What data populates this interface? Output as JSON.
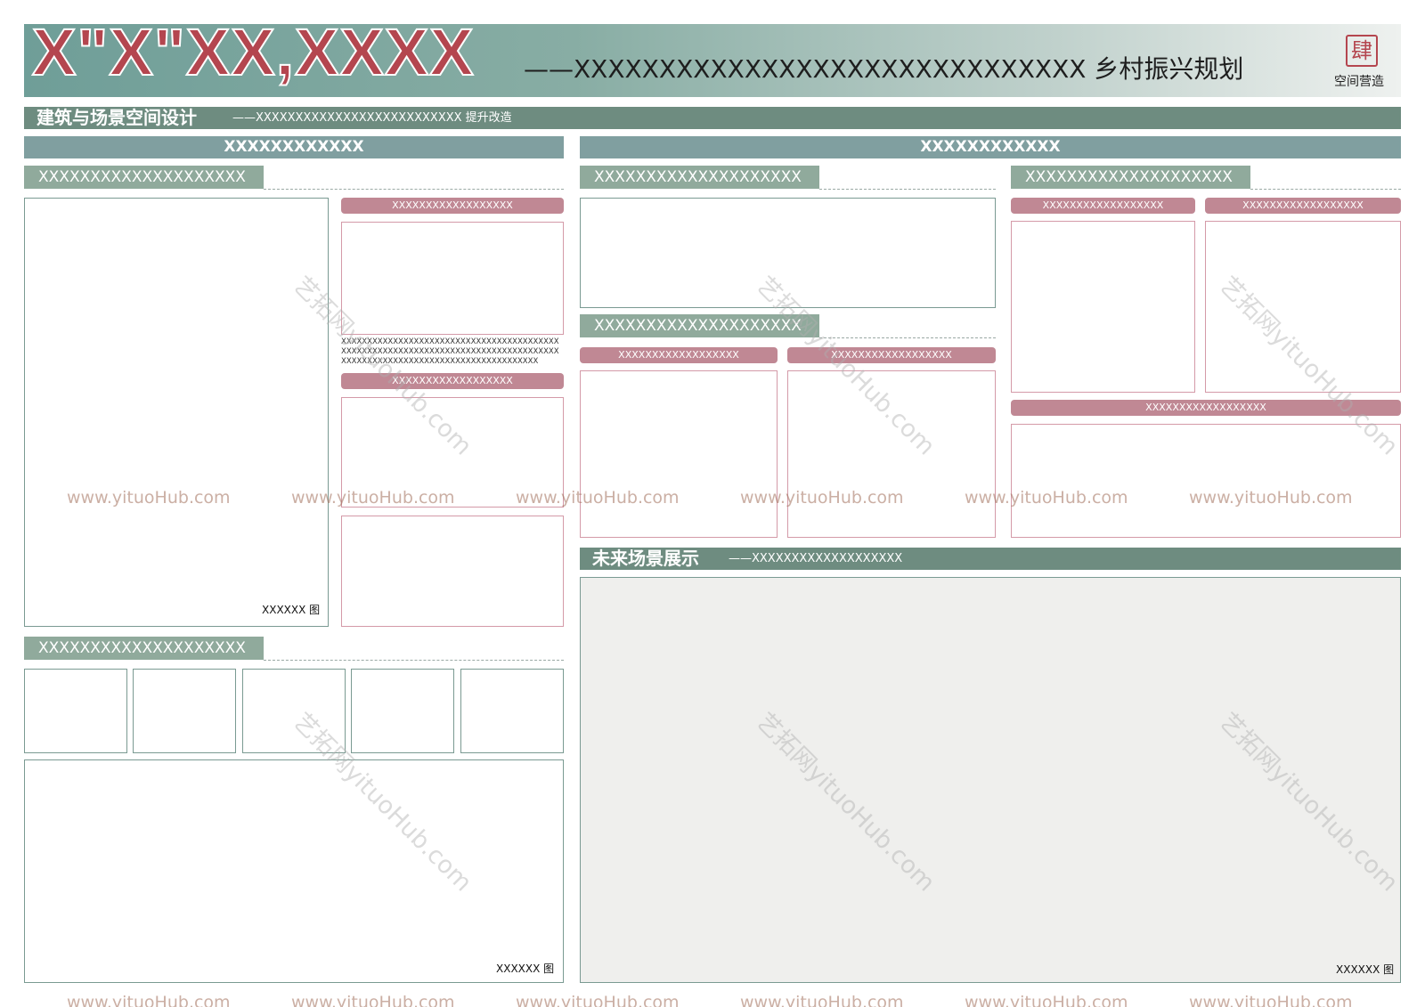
{
  "header": {
    "big_title": "X\"X\"XX,XXXX",
    "subtitle": "——XXXXXXXXXXXXXXXXXXXXXXXXXXXXXX 乡村振兴规划",
    "seal_char": "肆",
    "brand": "空间营造"
  },
  "section_bar": {
    "title": "建筑与场景空间设计",
    "subtitle": "——XXXXXXXXXXXXXXXXXXXXXXXXXX 提升改造"
  },
  "left_column": {
    "heading": "XXXXXXXXXXXX",
    "tab1": "XXXXXXXXXXXXXXXXXXXX",
    "main_caption": "XXXXXX 图",
    "pill1": "XXXXXXXXXXXXXXXXXX",
    "text_block": "XXXXXXXXXXXXXXXXXXXXXXXXXXXXXXXXXXXXXXXXXXXXXXXXXXXXXXXXXXXXXXXXXXXXXXXXXXXXXXXXXXXXXXXXXXXXXXXXXXXXXXXXXXXXXXXXXXXXXXXXXX",
    "pill2": "XXXXXXXXXXXXXXXXXX",
    "tab2": "XXXXXXXXXXXXXXXXXXXX",
    "bottom_caption": "XXXXXX 图"
  },
  "right_column": {
    "heading": "XXXXXXXXXXXX",
    "tab_a": "XXXXXXXXXXXXXXXXXXXX",
    "tab_b": "XXXXXXXXXXXXXXXXXXXX",
    "tab_c": "XXXXXXXXXXXXXXXXXXXX",
    "pill_b1": "XXXXXXXXXXXXXXXXXX",
    "pill_b2": "XXXXXXXXXXXXXXXXXX",
    "pill_c1": "XXXXXXXXXXXXXXXXXX",
    "pill_c2": "XXXXXXXXXXXXXXXXXX",
    "pill_c3": "XXXXXXXXXXXXXXXXXX"
  },
  "future_section": {
    "title": "未来场景展示",
    "subtitle": "——XXXXXXXXXXXXXXXXXXX",
    "caption": "XXXXXX 图"
  },
  "watermarks": {
    "url": "www.yituoHub.com",
    "diagonal": "艺拓网yituoHub.com"
  },
  "colors": {
    "accent_red": "#b4464f",
    "green_bar": "#6e8c80",
    "blue_head": "#809fa0",
    "green_tab": "#90aa9c",
    "pink_pill": "#c08894"
  }
}
